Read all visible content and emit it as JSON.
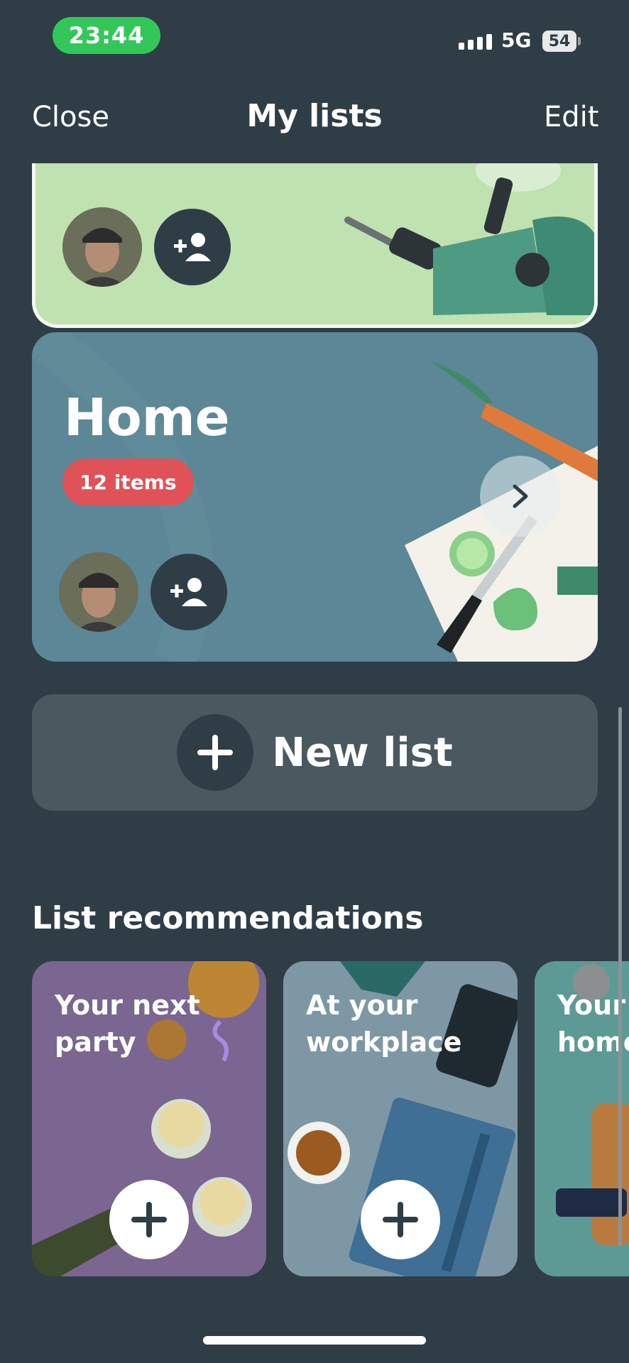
{
  "status_bar": {
    "time": "23:44",
    "network": "5G",
    "battery": "54"
  },
  "nav": {
    "close": "Close",
    "title": "My lists",
    "edit": "Edit"
  },
  "lists": [
    {
      "name": ""
    },
    {
      "name": "Home",
      "badge": "12 items"
    }
  ],
  "new_list": {
    "label": "New list"
  },
  "recommendations": {
    "title": "List recommendations",
    "items": [
      {
        "title": "Your next\nparty",
        "color": "#7a6690"
      },
      {
        "title": "At your\nworkplace",
        "color": "#7e97a4"
      },
      {
        "title": "Your\nhome",
        "color": "#5e9a95"
      }
    ]
  },
  "colors": {
    "background": "#2f3d47",
    "time_pill": "#33c759",
    "badge": "#e05257",
    "card_green": "#bfe2b0",
    "card_home": "#5b8796"
  }
}
